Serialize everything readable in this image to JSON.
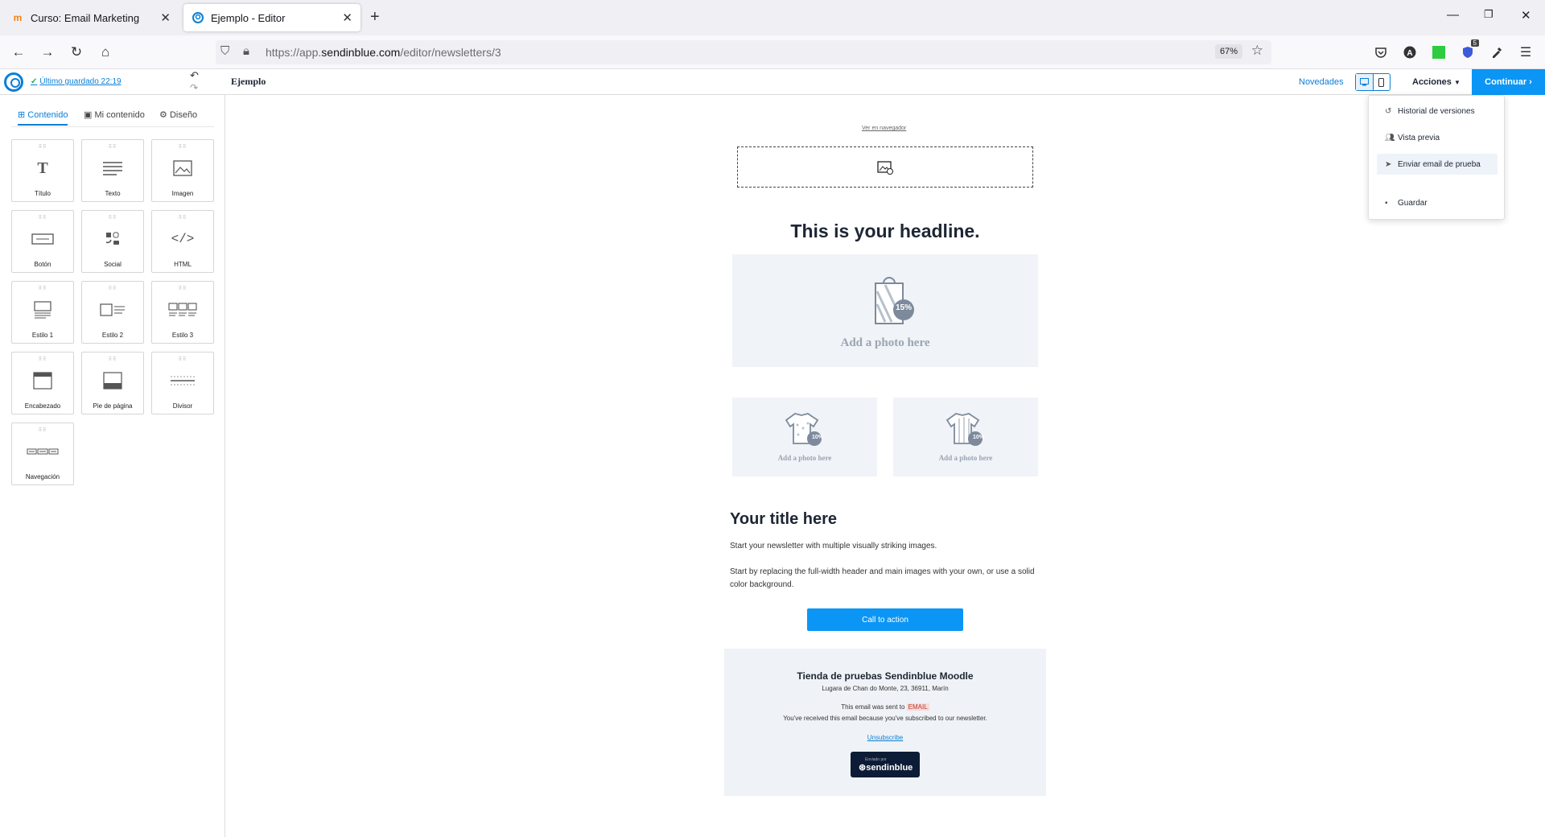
{
  "browser": {
    "tabs": [
      {
        "title": "Curso: Email Marketing",
        "active": false,
        "favicon": "m"
      },
      {
        "title": "Ejemplo - Editor",
        "active": true,
        "favicon": "sendinblue-logo"
      }
    ],
    "url_prefix": "https://app.",
    "url_domain": "sendinblue.com",
    "url_path": "/editor/newsletters/3",
    "zoom": "67%",
    "ext_badge": "5"
  },
  "app": {
    "saved_label": "Último guardado 22:19",
    "doc_title": "Ejemplo",
    "novedades": "Novedades",
    "acciones": "Acciones",
    "continuar": "Continuar"
  },
  "sidebar": {
    "tabs": [
      "Contenido",
      "Mi contenido",
      "Diseño"
    ],
    "blocks": [
      "Título",
      "Texto",
      "Imagen",
      "Botón",
      "Social",
      "HTML",
      "Estilo 1",
      "Estilo 2",
      "Estilo 3",
      "Encabezado",
      "Pie de página",
      "Divisor",
      "Navegación"
    ]
  },
  "email": {
    "view_in_browser": "Ver en navegador",
    "headline": "This is your headline.",
    "photo_label": "Add a photo here",
    "discount_big": "15%",
    "discount_small": "10%",
    "title": "Your title here",
    "paragraph1": "Start your newsletter with multiple visually striking images.",
    "paragraph2": "Start by replacing the full-width header and main images with your own, or use a solid color background.",
    "cta": "Call to action",
    "footer": {
      "company": "Tienda de pruebas Sendinblue Moodle",
      "address": "Lugara de Chan do Monte, 23, 36911, Marín",
      "sent_prefix": "This email was sent to",
      "email_tag": "EMAIL",
      "reason": "You've received this email because you've subscribed to our newsletter.",
      "unsubscribe": "Unsubscribe",
      "badge_small": "Enviado por",
      "badge_big": "sendinblue"
    }
  },
  "menu": {
    "items": [
      "Historial de versiones",
      "Vista previa",
      "Enviar email de prueba",
      "Guardar"
    ]
  }
}
